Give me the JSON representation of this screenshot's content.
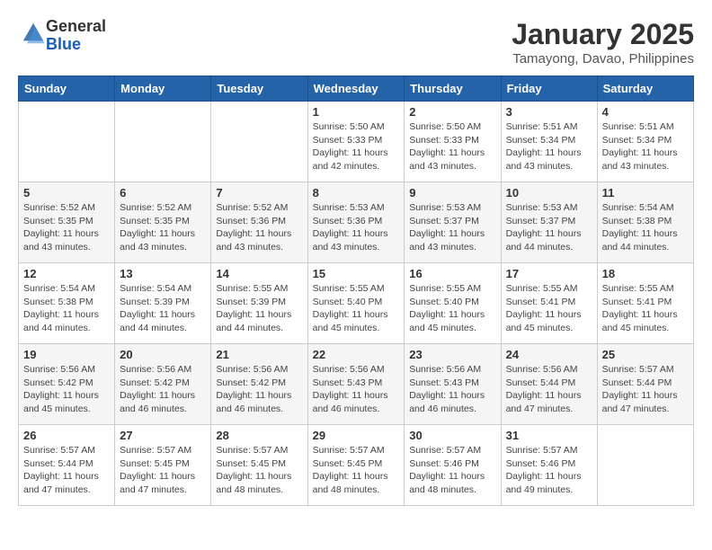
{
  "logo": {
    "general": "General",
    "blue": "Blue"
  },
  "header": {
    "month": "January 2025",
    "location": "Tamayong, Davao, Philippines"
  },
  "weekdays": [
    "Sunday",
    "Monday",
    "Tuesday",
    "Wednesday",
    "Thursday",
    "Friday",
    "Saturday"
  ],
  "weeks": [
    [
      {
        "day": "",
        "info": ""
      },
      {
        "day": "",
        "info": ""
      },
      {
        "day": "",
        "info": ""
      },
      {
        "day": "1",
        "info": "Sunrise: 5:50 AM\nSunset: 5:33 PM\nDaylight: 11 hours\nand 42 minutes."
      },
      {
        "day": "2",
        "info": "Sunrise: 5:50 AM\nSunset: 5:33 PM\nDaylight: 11 hours\nand 43 minutes."
      },
      {
        "day": "3",
        "info": "Sunrise: 5:51 AM\nSunset: 5:34 PM\nDaylight: 11 hours\nand 43 minutes."
      },
      {
        "day": "4",
        "info": "Sunrise: 5:51 AM\nSunset: 5:34 PM\nDaylight: 11 hours\nand 43 minutes."
      }
    ],
    [
      {
        "day": "5",
        "info": "Sunrise: 5:52 AM\nSunset: 5:35 PM\nDaylight: 11 hours\nand 43 minutes."
      },
      {
        "day": "6",
        "info": "Sunrise: 5:52 AM\nSunset: 5:35 PM\nDaylight: 11 hours\nand 43 minutes."
      },
      {
        "day": "7",
        "info": "Sunrise: 5:52 AM\nSunset: 5:36 PM\nDaylight: 11 hours\nand 43 minutes."
      },
      {
        "day": "8",
        "info": "Sunrise: 5:53 AM\nSunset: 5:36 PM\nDaylight: 11 hours\nand 43 minutes."
      },
      {
        "day": "9",
        "info": "Sunrise: 5:53 AM\nSunset: 5:37 PM\nDaylight: 11 hours\nand 43 minutes."
      },
      {
        "day": "10",
        "info": "Sunrise: 5:53 AM\nSunset: 5:37 PM\nDaylight: 11 hours\nand 44 minutes."
      },
      {
        "day": "11",
        "info": "Sunrise: 5:54 AM\nSunset: 5:38 PM\nDaylight: 11 hours\nand 44 minutes."
      }
    ],
    [
      {
        "day": "12",
        "info": "Sunrise: 5:54 AM\nSunset: 5:38 PM\nDaylight: 11 hours\nand 44 minutes."
      },
      {
        "day": "13",
        "info": "Sunrise: 5:54 AM\nSunset: 5:39 PM\nDaylight: 11 hours\nand 44 minutes."
      },
      {
        "day": "14",
        "info": "Sunrise: 5:55 AM\nSunset: 5:39 PM\nDaylight: 11 hours\nand 44 minutes."
      },
      {
        "day": "15",
        "info": "Sunrise: 5:55 AM\nSunset: 5:40 PM\nDaylight: 11 hours\nand 45 minutes."
      },
      {
        "day": "16",
        "info": "Sunrise: 5:55 AM\nSunset: 5:40 PM\nDaylight: 11 hours\nand 45 minutes."
      },
      {
        "day": "17",
        "info": "Sunrise: 5:55 AM\nSunset: 5:41 PM\nDaylight: 11 hours\nand 45 minutes."
      },
      {
        "day": "18",
        "info": "Sunrise: 5:55 AM\nSunset: 5:41 PM\nDaylight: 11 hours\nand 45 minutes."
      }
    ],
    [
      {
        "day": "19",
        "info": "Sunrise: 5:56 AM\nSunset: 5:42 PM\nDaylight: 11 hours\nand 45 minutes."
      },
      {
        "day": "20",
        "info": "Sunrise: 5:56 AM\nSunset: 5:42 PM\nDaylight: 11 hours\nand 46 minutes."
      },
      {
        "day": "21",
        "info": "Sunrise: 5:56 AM\nSunset: 5:42 PM\nDaylight: 11 hours\nand 46 minutes."
      },
      {
        "day": "22",
        "info": "Sunrise: 5:56 AM\nSunset: 5:43 PM\nDaylight: 11 hours\nand 46 minutes."
      },
      {
        "day": "23",
        "info": "Sunrise: 5:56 AM\nSunset: 5:43 PM\nDaylight: 11 hours\nand 46 minutes."
      },
      {
        "day": "24",
        "info": "Sunrise: 5:56 AM\nSunset: 5:44 PM\nDaylight: 11 hours\nand 47 minutes."
      },
      {
        "day": "25",
        "info": "Sunrise: 5:57 AM\nSunset: 5:44 PM\nDaylight: 11 hours\nand 47 minutes."
      }
    ],
    [
      {
        "day": "26",
        "info": "Sunrise: 5:57 AM\nSunset: 5:44 PM\nDaylight: 11 hours\nand 47 minutes."
      },
      {
        "day": "27",
        "info": "Sunrise: 5:57 AM\nSunset: 5:45 PM\nDaylight: 11 hours\nand 47 minutes."
      },
      {
        "day": "28",
        "info": "Sunrise: 5:57 AM\nSunset: 5:45 PM\nDaylight: 11 hours\nand 48 minutes."
      },
      {
        "day": "29",
        "info": "Sunrise: 5:57 AM\nSunset: 5:45 PM\nDaylight: 11 hours\nand 48 minutes."
      },
      {
        "day": "30",
        "info": "Sunrise: 5:57 AM\nSunset: 5:46 PM\nDaylight: 11 hours\nand 48 minutes."
      },
      {
        "day": "31",
        "info": "Sunrise: 5:57 AM\nSunset: 5:46 PM\nDaylight: 11 hours\nand 49 minutes."
      },
      {
        "day": "",
        "info": ""
      }
    ]
  ]
}
